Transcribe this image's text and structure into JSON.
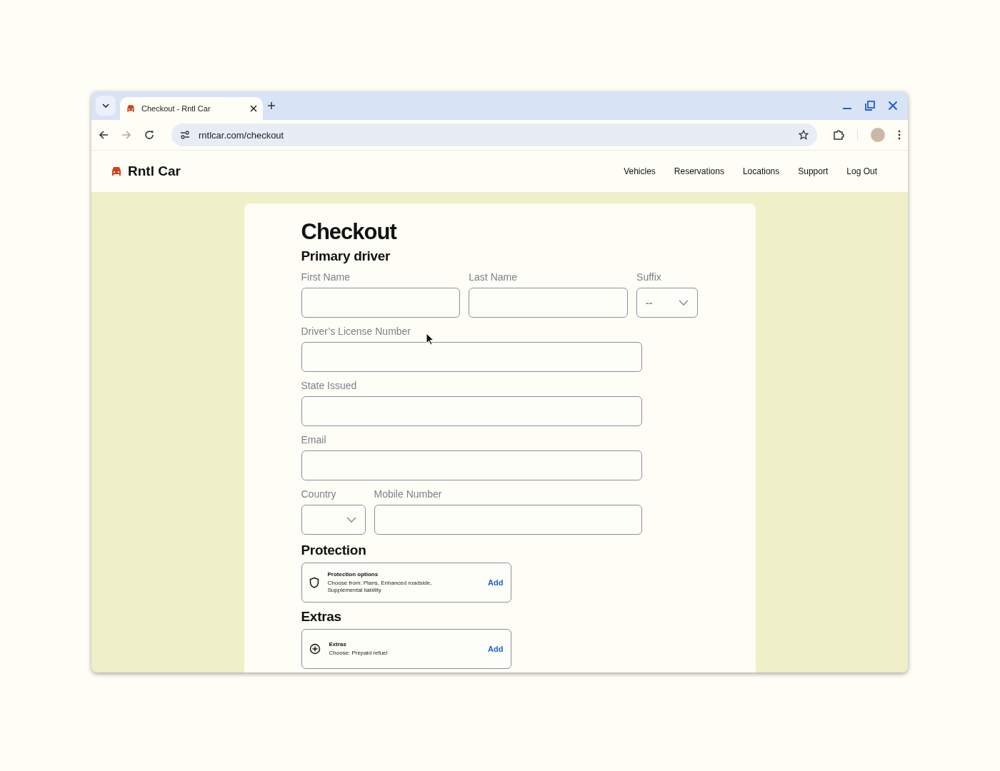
{
  "browser": {
    "tab_title": "Checkout - Rntl Car",
    "url": "rntlcar.com/checkout"
  },
  "site": {
    "brand": "Rntl Car",
    "nav": [
      "Vehicles",
      "Reservations",
      "Locations",
      "Support",
      "Log Out"
    ]
  },
  "checkout": {
    "title": "Checkout",
    "section": "Primary driver",
    "rows": [
      [
        {
          "label": "First Name",
          "kind": "text"
        },
        {
          "label": "Last Name",
          "kind": "text"
        },
        {
          "label": "Suffix",
          "kind": "select",
          "value": "--"
        }
      ],
      [
        {
          "label": "Driver’s License Number",
          "kind": "text"
        }
      ],
      [
        {
          "label": "State Issued",
          "kind": "text"
        }
      ],
      [
        {
          "label": "Email",
          "kind": "text"
        }
      ],
      [
        {
          "label": "Country",
          "kind": "select"
        },
        {
          "label": "Mobile Number",
          "kind": "text"
        }
      ]
    ]
  },
  "options": [
    {
      "heading": "Protection",
      "title": "Protection options",
      "description": "Choose from: Plans, Enhanced roadside, Supplemental liability",
      "action": "Add"
    },
    {
      "heading": "Extras",
      "title": "Extras",
      "description": "Choose: Prepaid refuel",
      "action": "Add"
    }
  ]
}
